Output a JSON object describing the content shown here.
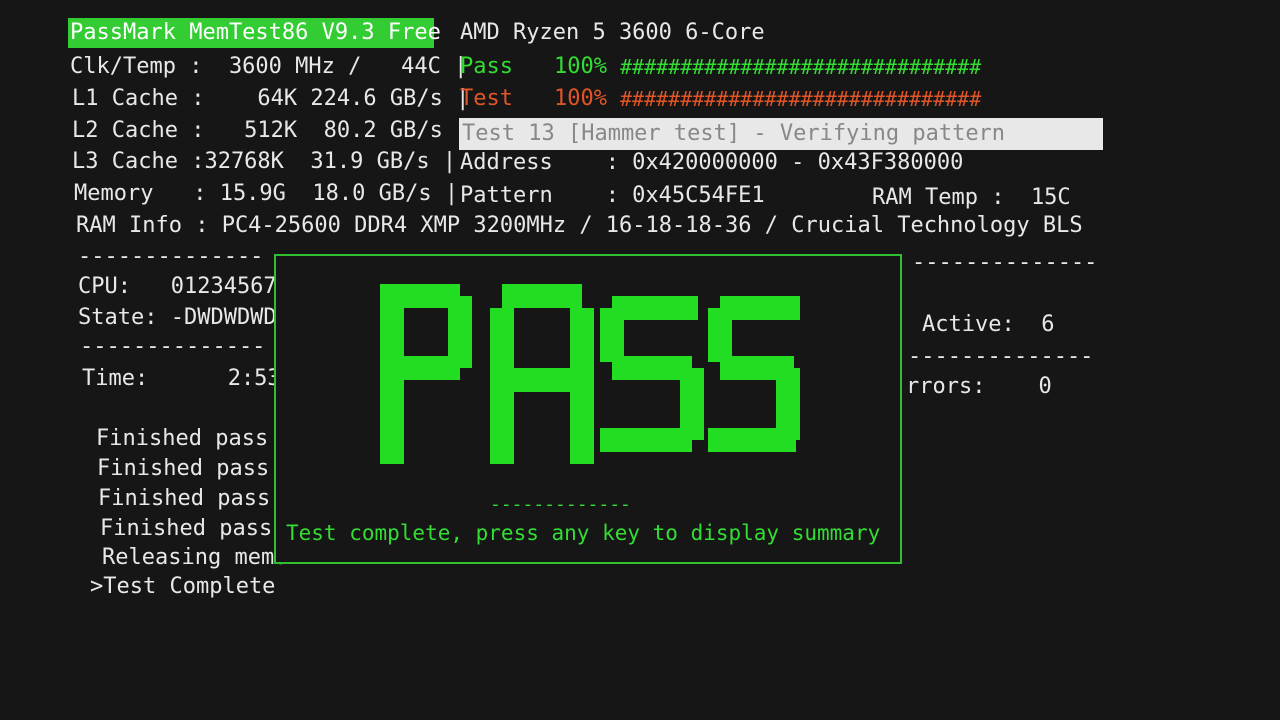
{
  "header": {
    "app_title": "PassMark MemTest86 V9.3 Free",
    "cpu_name": "AMD Ryzen 5 3600 6-Core"
  },
  "system": {
    "clk_temp": "Clk/Temp :  3600 MHz /   44C |",
    "l1_cache": "L1 Cache :    64K 224.6 GB/s |",
    "l2_cache": "L2 Cache :   512K  80.2 GB/s |",
    "l3_cache": "L3 Cache :32768K  31.9 GB/s |",
    "memory": "Memory   : 15.9G  18.0 GB/s |",
    "ram_info": "RAM Info : PC4-25600 DDR4 XMP 3200MHz / 16-18-18-36 / Crucial Technology BLS"
  },
  "progress": {
    "pass_label": "Pass",
    "pass_percent": "100%",
    "pass_bar": "##############################",
    "test_label": "Test",
    "test_percent": "100%",
    "test_bar": "##############################",
    "pass_fraction": 1.0,
    "test_fraction": 1.0
  },
  "current_test": {
    "status": "Test 13 [Hammer test] - Verifying pattern",
    "address": "Address    : 0x420000000 - 0x43F380000",
    "pattern": "Pattern    : 0x45C54FE1",
    "ram_temp": "RAM Temp :  15C"
  },
  "left_panel": {
    "divider_top": "--------------",
    "cpu": "CPU:   01234567",
    "state": "State: -DWDWDWD",
    "divider_mid": "--------------",
    "time": "Time:      2:53:"
  },
  "right_panel": {
    "divider_top": "--------------",
    "active": "Active:  6",
    "divider_mid": "--------------",
    "errors": "rrors:    0"
  },
  "log": [
    "Finished pass",
    "Finished pass",
    "Finished pass",
    "Finished pass",
    "Releasing memo",
    ">Test Complete"
  ],
  "result": {
    "word": "PASS",
    "divider": "-------------",
    "message": "Test complete, press any key to display summary"
  },
  "colors": {
    "green": "#33dd33",
    "red": "#e05528",
    "title_bg": "#33cc33",
    "background": "#161616"
  }
}
